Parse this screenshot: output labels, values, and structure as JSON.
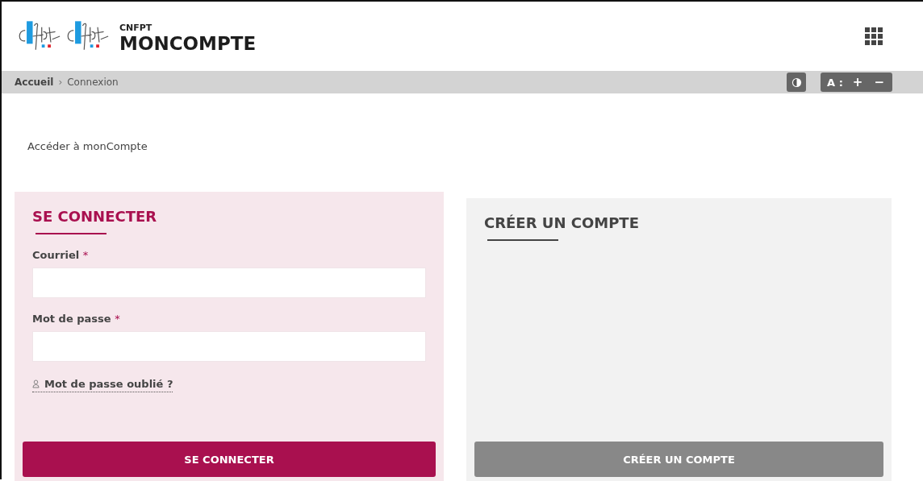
{
  "header": {
    "org": "CNFPT",
    "title": "MONCOMPTE"
  },
  "breadcrumb_separator": "›",
  "breadcrumb": [
    {
      "label": "Accueil",
      "current": false
    },
    {
      "label": "Connexion",
      "current": true
    }
  ],
  "accessibility": {
    "font_label": "A :",
    "increase": "+",
    "decrease": "−"
  },
  "page_title": "Accéder à monCompte",
  "cards": [
    {
      "kind": "login",
      "title": "SE CONNECTER",
      "fields": [
        {
          "label": "Courriel",
          "mark": "*"
        },
        {
          "label": "Mot de passe",
          "mark": "*"
        }
      ],
      "link": "Mot de passe oublié ?",
      "button": "SE CONNECTER"
    },
    {
      "kind": "signup",
      "title": "CRÉER UN COMPTE",
      "button": "CRÉER UN COMPTE"
    }
  ]
}
